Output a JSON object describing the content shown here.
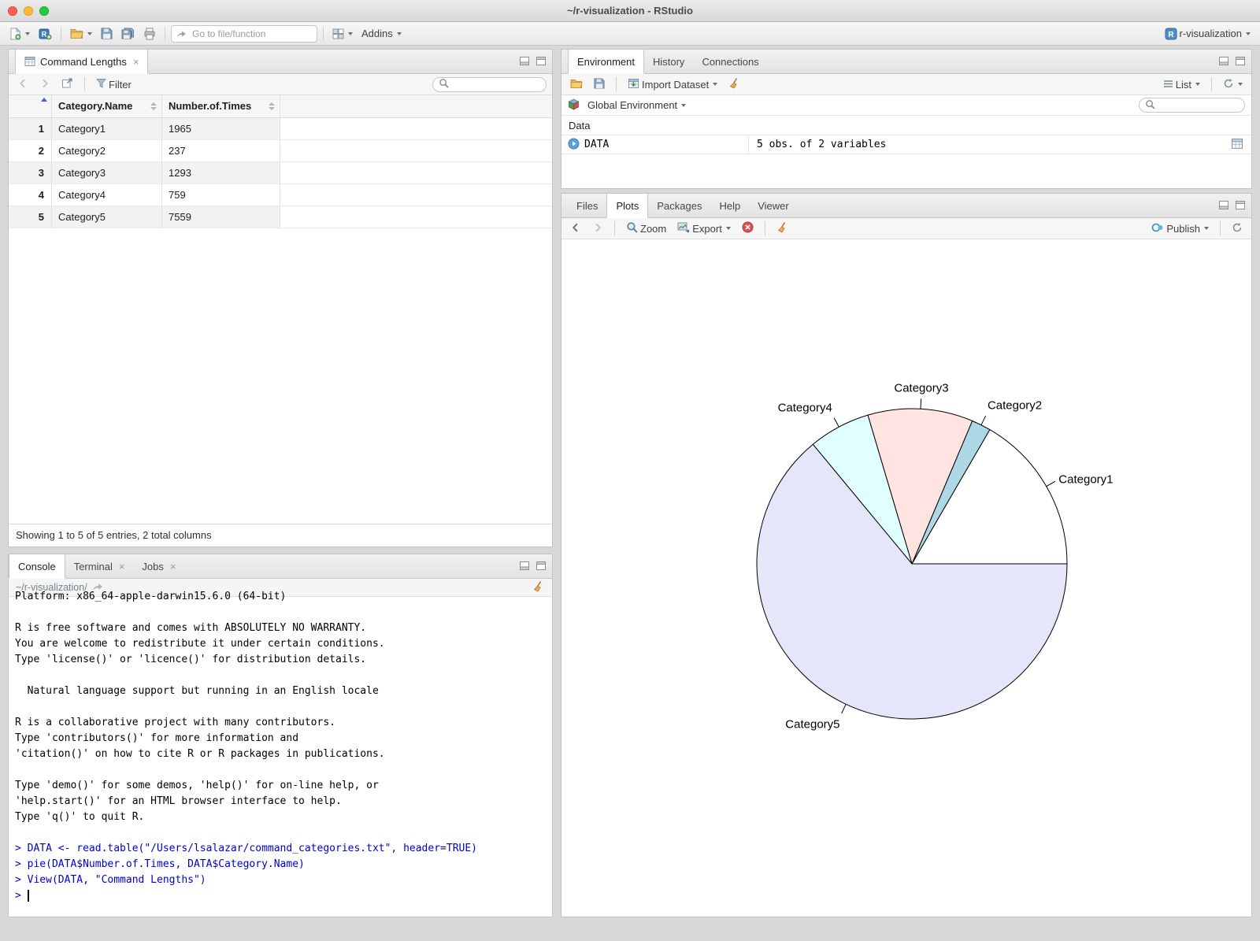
{
  "window": {
    "title": "~/r-visualization - RStudio",
    "project": "r-visualization"
  },
  "colors": {
    "input_blue": "#0000cd",
    "traffic_red": "#ff5f57",
    "traffic_yellow": "#febc2e",
    "traffic_green": "#28c840",
    "pane_border": "#c3c3c3"
  },
  "icons": {
    "new-file-icon": "document-plus",
    "new-project-icon": "r-cube-plus",
    "open-folder-icon": "folder",
    "save-icon": "floppy",
    "save-all-icon": "floppy-stack",
    "print-icon": "printer",
    "goto-icon": "arrow-right",
    "panes-layout-icon": "grid-2x2",
    "project-icon": "r-badge",
    "dataframe-icon": "table-grid",
    "back-icon": "chevron-left",
    "forward-icon": "chevron-right",
    "popout-icon": "window-arrow",
    "filter-icon": "funnel",
    "search-icon": "magnifier",
    "minimize-pane-icon": "window-min",
    "maximize-pane-icon": "window-max",
    "close-icon": "x",
    "clear-icon": "broom",
    "import-dataset-icon": "table-import",
    "list-view-icon": "hamburger",
    "refresh-icon": "circular-arrow",
    "global-env-icon": "cube",
    "promise-icon": "play-circle",
    "zoom-icon": "magnifier",
    "export-icon": "image",
    "remove-plot-icon": "red-circle-x",
    "publish-icon": "double-circle",
    "share-icon": "curved-arrow",
    "sort-icon": "up-down-triangles",
    "sort-asc-icon": "blue-triangle-up"
  },
  "main_toolbar": {
    "goto_placeholder": "Go to file/function",
    "addins_label": "Addins"
  },
  "data_viewer": {
    "tab_title": "Command Lengths",
    "filter_label": "Filter",
    "columns": [
      "Category.Name",
      "Number.of.Times"
    ],
    "rows": [
      {
        "num": "1",
        "name": "Category1",
        "times": "1965"
      },
      {
        "num": "2",
        "name": "Category2",
        "times": "237"
      },
      {
        "num": "3",
        "name": "Category3",
        "times": "1293"
      },
      {
        "num": "4",
        "name": "Category4",
        "times": "759"
      },
      {
        "num": "5",
        "name": "Category5",
        "times": "7559"
      }
    ],
    "footer": "Showing 1 to 5 of 5 entries, 2 total columns"
  },
  "console_pane": {
    "tabs": [
      {
        "label": "Console",
        "closable": false
      },
      {
        "label": "Terminal",
        "closable": true
      },
      {
        "label": "Jobs",
        "closable": true
      }
    ],
    "path": "~/r-visualization/",
    "input_color": "#0000cd",
    "lines": [
      {
        "type": "output",
        "text": "Platform: x86_64-apple-darwin15.6.0 (64-bit)"
      },
      {
        "type": "output",
        "text": ""
      },
      {
        "type": "output",
        "text": "R is free software and comes with ABSOLUTELY NO WARRANTY."
      },
      {
        "type": "output",
        "text": "You are welcome to redistribute it under certain conditions."
      },
      {
        "type": "output",
        "text": "Type 'license()' or 'licence()' for distribution details."
      },
      {
        "type": "output",
        "text": ""
      },
      {
        "type": "output",
        "text": "  Natural language support but running in an English locale"
      },
      {
        "type": "output",
        "text": ""
      },
      {
        "type": "output",
        "text": "R is a collaborative project with many contributors."
      },
      {
        "type": "output",
        "text": "Type 'contributors()' for more information and"
      },
      {
        "type": "output",
        "text": "'citation()' on how to cite R or R packages in publications."
      },
      {
        "type": "output",
        "text": ""
      },
      {
        "type": "output",
        "text": "Type 'demo()' for some demos, 'help()' for on-line help, or"
      },
      {
        "type": "output",
        "text": "'help.start()' for an HTML browser interface to help."
      },
      {
        "type": "output",
        "text": "Type 'q()' to quit R."
      },
      {
        "type": "output",
        "text": ""
      },
      {
        "type": "input",
        "text": "> DATA <- read.table(\"/Users/lsalazar/command_categories.txt\", header=TRUE)"
      },
      {
        "type": "input",
        "text": "> pie(DATA$Number.of.Times, DATA$Category.Name)"
      },
      {
        "type": "input",
        "text": "> View(DATA, \"Command Lengths\")"
      },
      {
        "type": "input",
        "cursor": true,
        "text": "> "
      }
    ]
  },
  "environment_pane": {
    "tabs": [
      "Environment",
      "History",
      "Connections"
    ],
    "import_dataset_label": "Import Dataset",
    "list_label": "List",
    "scope_label": "Global Environment",
    "section_label": "Data",
    "object": {
      "name": "DATA",
      "description": "5 obs. of 2 variables"
    }
  },
  "plots_pane": {
    "tabs": [
      "Files",
      "Plots",
      "Packages",
      "Help",
      "Viewer"
    ],
    "zoom_label": "Zoom",
    "export_label": "Export",
    "publish_label": "Publish"
  },
  "chart_data": {
    "type": "pie",
    "title": "",
    "categories": [
      "Category1",
      "Category2",
      "Category3",
      "Category4",
      "Category5"
    ],
    "values": [
      1965,
      237,
      1293,
      759,
      7559
    ],
    "colors": [
      "#ffffff",
      "#add8e6",
      "#ffe4e1",
      "#e0ffff",
      "#e6e6fa"
    ],
    "stroke": "#000000",
    "start_angle_deg": 0,
    "direction": "counterclockwise",
    "legend": "labels-around-slices"
  }
}
